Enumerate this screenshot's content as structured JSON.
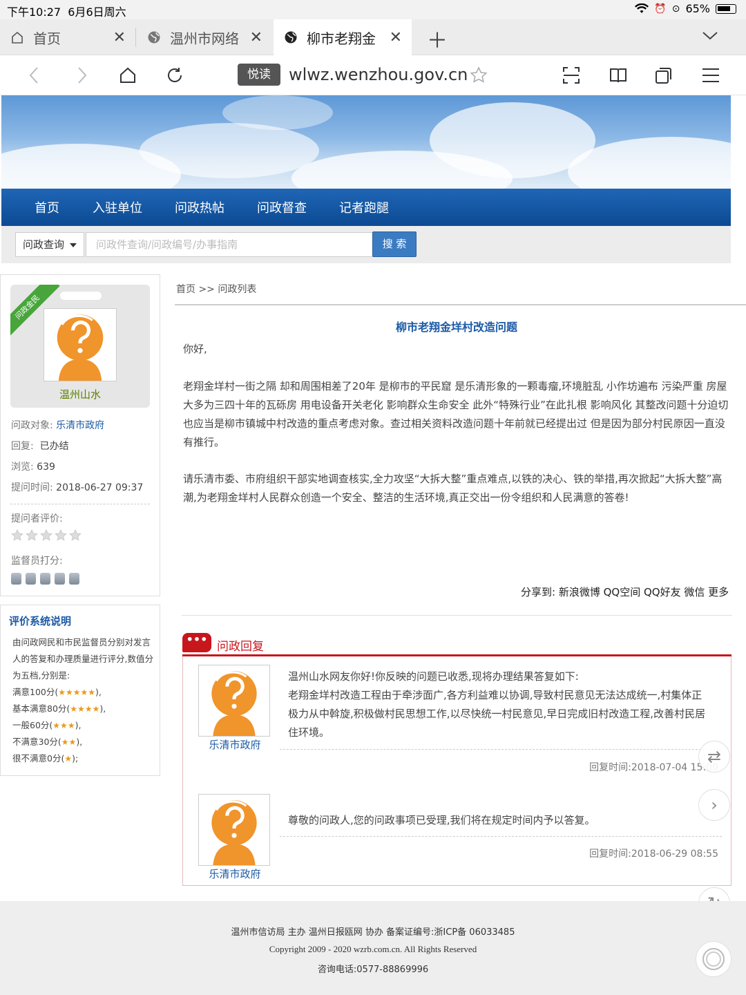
{
  "status_bar": {
    "time": "下午10:27",
    "date": "6月6日周六",
    "battery": "65%",
    "battery_fill": 0.65
  },
  "tabs": [
    {
      "label": "首页",
      "icon": "home-icon"
    },
    {
      "label": "温州市网络",
      "icon": "globe-icon"
    },
    {
      "label": "柳市老翔金",
      "icon": "globe-icon",
      "active": true
    }
  ],
  "address_bar": {
    "reader_label": "悦读",
    "url": "wlwz.wenzhou.gov.cn"
  },
  "main_nav": [
    "首页",
    "入驻单位",
    "问政热帖",
    "问政督查",
    "记者跑腿"
  ],
  "search": {
    "select_value": "问政查询",
    "placeholder": "问政件查询/问政编号/办事指南",
    "button": "搜 索"
  },
  "profile": {
    "ribbon": "问政金民",
    "name": "温州山水",
    "target_label": "问政对象:",
    "target_value": "乐清市政府",
    "reply_label": "回复:",
    "reply_value": "已办结",
    "views_label": "浏览:",
    "views_value": "639",
    "time_label": "提问时间:",
    "time_value": "2018-06-27 09:37",
    "rating_label": "提问者评价:",
    "supervisor_label": "监督员打分:"
  },
  "eval_box": {
    "title": "评价系统说明",
    "desc": "由问政网民和市民监督员分别对发言人的答复和办理质量进行评分,数值分为五档,分别是:",
    "levels": [
      {
        "label": "满意100分(",
        "stars": "★★★★★",
        "end": "),"
      },
      {
        "label": "基本满意80分(",
        "stars": "★★★★",
        "end": "),"
      },
      {
        "label": "一般60分(",
        "stars": "★★★",
        "end": "),"
      },
      {
        "label": "不满意30分(",
        "stars": "★★",
        "end": "),"
      },
      {
        "label": "很不满意0分(",
        "stars": "★",
        "end": ");"
      }
    ]
  },
  "breadcrumb": "首页 >> 问政列表",
  "question": {
    "title": "柳市老翔金垟村改造问题",
    "greeting": "你好,",
    "para1": "老翔金垟村一街之隔 却和周围相差了20年 是柳市的平民窟 是乐清形象的一颗毒瘤,环境脏乱 小作坊遍布 污染严重 房屋大多为三四十年的瓦砾房 用电设备开关老化 影响群众生命安全 此外“特殊行业”在此扎根 影响风化 其整改问题十分迫切 也应当是柳市镇城中村改造的重点考虑对象。查过相关资料改造问题十年前就已经提出过 但是因为部分村民原因一直没有推行。",
    "para2": "请乐清市委、市府组织干部实地调查核实,全力攻坚“大拆大整”重点难点,以铁的决心、铁的举措,再次掀起“大拆大整”高潮,为老翔金垟村人民群众创造一个安全、整洁的生活环境,真正交出一份令组织和人民满意的答卷!"
  },
  "share": "分享到: 新浪微博 QQ空间 QQ好友 微信 更多",
  "reply_section": {
    "badge": "•••",
    "title": "问政回复"
  },
  "replies": [
    {
      "name": "乐清市政府",
      "text": "温州山水网友你好!你反映的问题已收悉,现将办理结果答复如下:\n老翔金垟村改造工程由于牵涉面广,各方利益难以协调,导致村民意见无法达成统一,村集体正极力从中斡旋,积极做村民思想工作,以尽快统一村民意见,早日完成旧村改造工程,改善村民居住环境。",
      "time": "回复时间:2018-07-04 15:00"
    },
    {
      "name": "乐清市政府",
      "text": "尊敬的问政人,您的问政事项已受理,我们将在规定时间内予以答复。",
      "time": "回复时间:2018-06-29 08:55"
    }
  ],
  "footer": {
    "line1": "温州市信访局 主办 温州日报瓯网 协办 备案证编号:浙ICP备 06033485",
    "line2": "Copyright 2009 - 2020 wzrb.com.cn. All Rights Reserved",
    "line3": "咨询电话:0577-88869996"
  },
  "colors": {
    "nav_blue": "#0c4a93",
    "link_blue": "#1b5aa5",
    "reply_red": "#c8161d",
    "avatar_orange": "#f0942c"
  }
}
